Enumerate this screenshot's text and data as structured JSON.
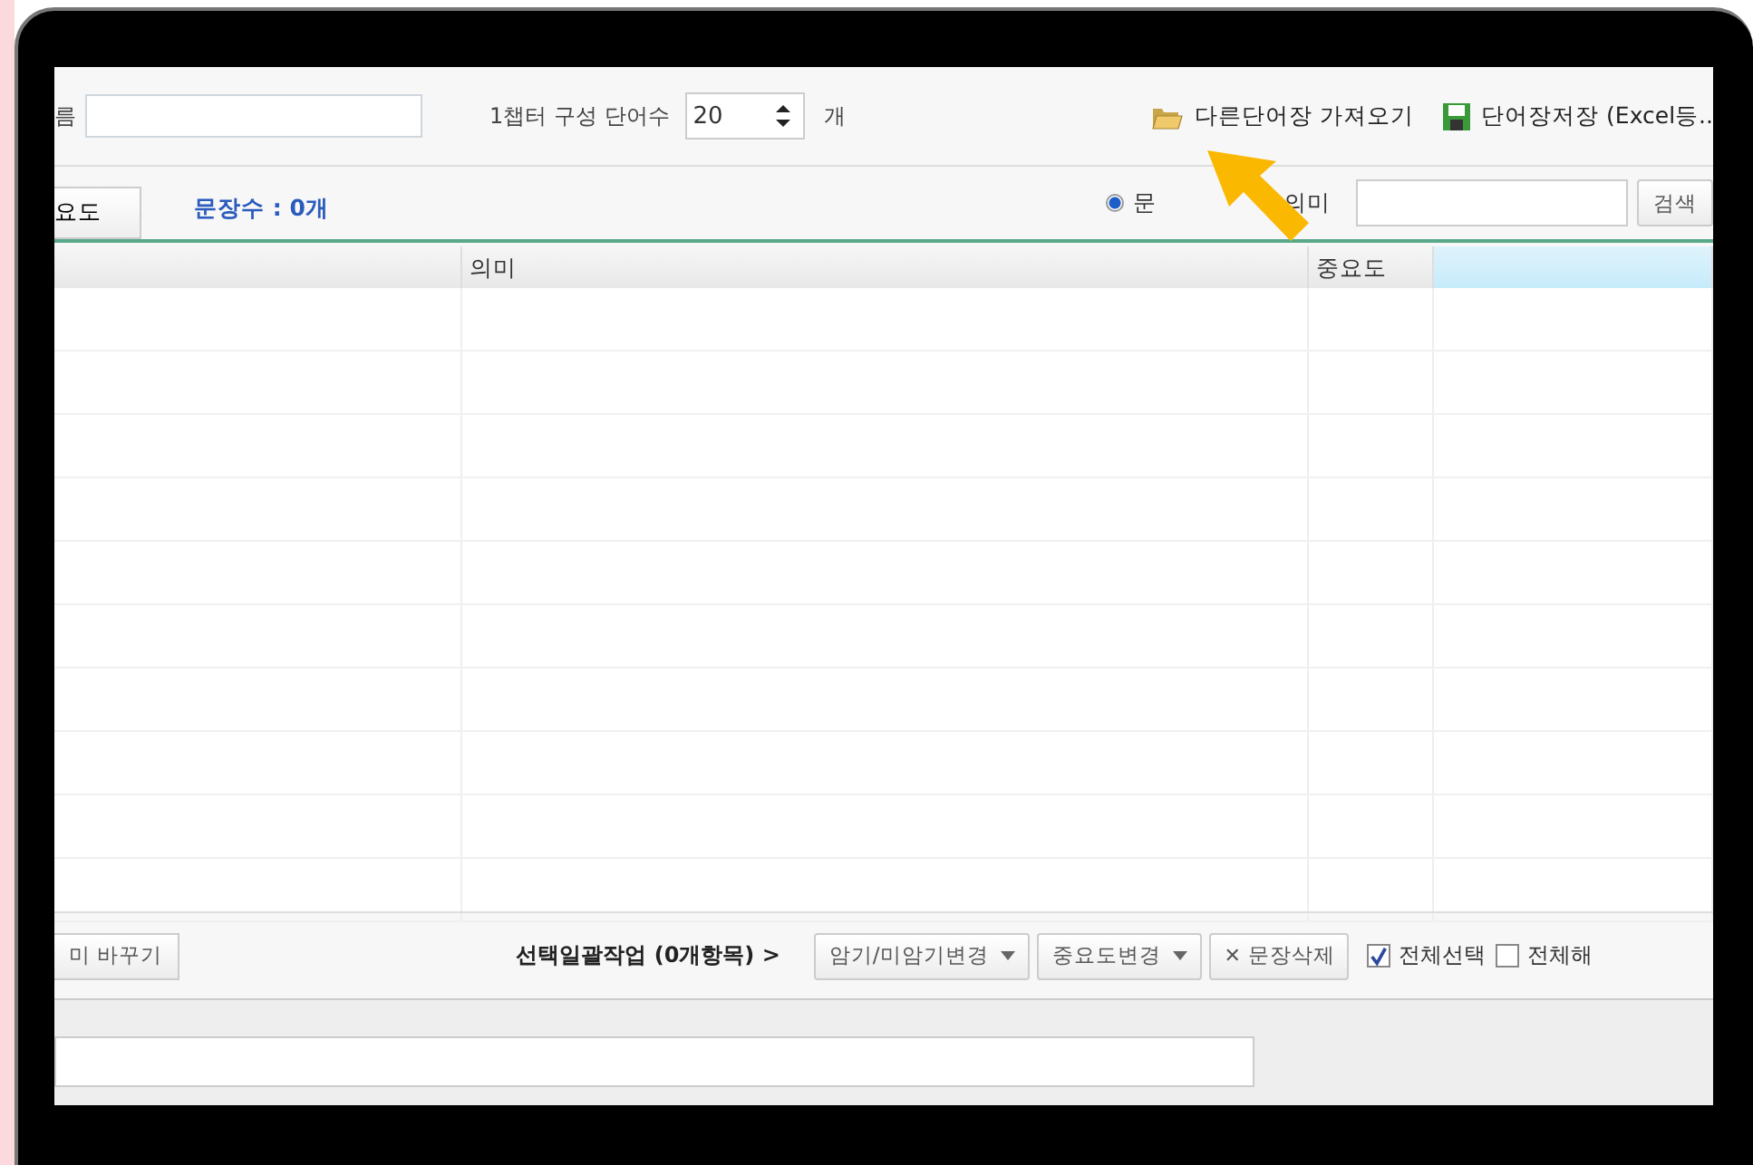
{
  "toolbar": {
    "name_label": "름",
    "chapter_label": "1챕터 구성 단어수",
    "chapter_count": "20",
    "unit": "개",
    "import_button": "다른단어장 가져오기",
    "save_button": "단어장저장 (Excel등.."
  },
  "subbar": {
    "tab": "요도",
    "count": "문장수 : 0개",
    "radios": [
      {
        "label": "문",
        "selected": true,
        "kind": "radio"
      },
      {
        "label": "의미",
        "kind": "bare"
      }
    ],
    "search_button": "검색"
  },
  "table": {
    "columns": [
      "",
      "의미",
      "중요도",
      ""
    ]
  },
  "bottom": {
    "swap_button": "미 바꾸기",
    "batch_label": "선택일괄작업 (0개항목) >",
    "actions": [
      {
        "label": "암기/미암기변경",
        "kind": "dropdown"
      },
      {
        "label": "중요도변경",
        "kind": "dropdown"
      },
      {
        "label": "문장삭제",
        "kind": "delete",
        "icon": "✕"
      }
    ],
    "checks": [
      {
        "label": "전체선택",
        "checked": true
      },
      {
        "label": "전체해",
        "checked": false
      }
    ]
  },
  "annotation": {
    "kind": "arrow"
  }
}
